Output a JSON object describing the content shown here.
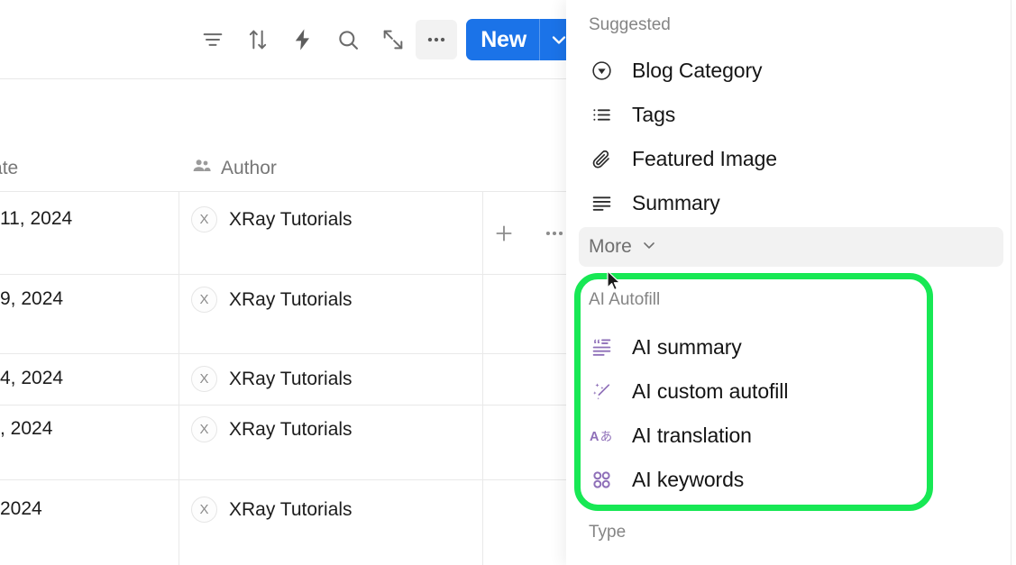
{
  "toolbar": {
    "icons": [
      {
        "name": "filter-icon",
        "label": "Filter"
      },
      {
        "name": "sort-icon",
        "label": "Sort"
      },
      {
        "name": "automation-lightning-icon",
        "label": "Automations"
      },
      {
        "name": "search-icon",
        "label": "Search"
      },
      {
        "name": "expand-icon",
        "label": "Expand"
      },
      {
        "name": "more-horizontal-icon",
        "label": "More"
      }
    ],
    "new_button": {
      "label": "New",
      "caret_icon": "chevron-down-icon",
      "color": "#1b73e8"
    }
  },
  "table": {
    "columns": [
      {
        "name": "publication-date",
        "header": "ion Date",
        "icon": ""
      },
      {
        "name": "author",
        "header": "Author",
        "icon": "people-icon"
      }
    ],
    "header_actions": [
      {
        "name": "add-column-button",
        "icon": "plus-icon"
      },
      {
        "name": "column-options-button",
        "icon": "more-horizontal-icon"
      }
    ],
    "rows": [
      {
        "date": "11, 2024",
        "author": "XRay Tutorials",
        "avatar": "X"
      },
      {
        "date": "9, 2024",
        "author": "XRay Tutorials",
        "avatar": "X"
      },
      {
        "date": "4, 2024",
        "author": "XRay Tutorials",
        "avatar": "X"
      },
      {
        "date": ", 2024",
        "author": "XRay Tutorials",
        "avatar": "X"
      },
      {
        "date": "2024",
        "author": "XRay Tutorials",
        "avatar": "X"
      }
    ]
  },
  "panel": {
    "suggested": {
      "label": "Suggested",
      "items": [
        {
          "label": "Blog Category",
          "icon": "select-circle-icon"
        },
        {
          "label": "Tags",
          "icon": "bulleted-list-icon"
        },
        {
          "label": "Featured Image",
          "icon": "paperclip-icon"
        },
        {
          "label": "Summary",
          "icon": "text-lines-icon"
        }
      ]
    },
    "more": {
      "label": "More",
      "icon": "chevron-down-icon"
    },
    "ai_autofill": {
      "label": "AI Autofill",
      "accent_color": "#8e6fb8",
      "items": [
        {
          "label": "AI summary",
          "icon": "ai-summary-quote-icon"
        },
        {
          "label": "AI custom autofill",
          "icon": "magic-wand-sparkle-icon"
        },
        {
          "label": "AI translation",
          "icon": "translate-a-icon"
        },
        {
          "label": "AI keywords",
          "icon": "four-circles-grid-icon"
        }
      ]
    },
    "type": {
      "label": "Type"
    }
  },
  "annotation": {
    "highlight_color": "#17e854",
    "target": "AI Autofill"
  }
}
